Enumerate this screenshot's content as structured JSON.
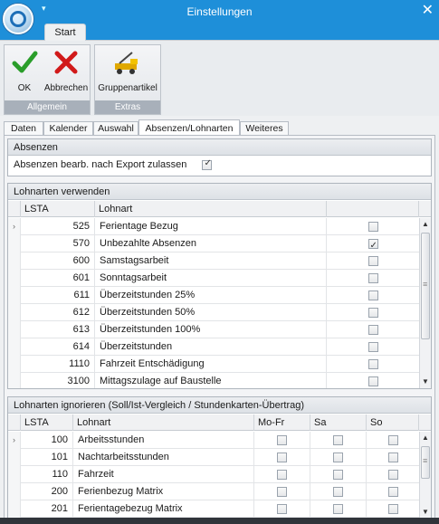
{
  "window": {
    "title": "Einstellungen",
    "close_glyph": "✕",
    "qat_glyph": "▾"
  },
  "ribbon": {
    "tab": "Start",
    "groups": [
      {
        "label": "Allgemein",
        "buttons": [
          {
            "label": "OK",
            "icon": "green-check-icon"
          },
          {
            "label": "Abbrechen",
            "icon": "red-x-icon"
          }
        ]
      },
      {
        "label": "Extras",
        "buttons": [
          {
            "label": "Gruppenartikel",
            "icon": "crane-truck-icon"
          }
        ]
      }
    ]
  },
  "tabs": [
    "Daten",
    "Kalender",
    "Auswahl",
    "Absenzen/Lohnarten",
    "Weiteres"
  ],
  "active_tab": "Absenzen/Lohnarten",
  "absenzen": {
    "header": "Absenzen",
    "option_label": "Absenzen bearb. nach Export zulassen",
    "option_checked": true
  },
  "lohnarten_verwenden": {
    "header": "Lohnarten verwenden",
    "columns": [
      "LSTA",
      "Lohnart",
      ""
    ],
    "rows": [
      {
        "lsta": "525",
        "lohnart": "Ferientage Bezug",
        "checked": false
      },
      {
        "lsta": "570",
        "lohnart": "Unbezahlte Absenzen",
        "checked": true
      },
      {
        "lsta": "600",
        "lohnart": "Samstagsarbeit",
        "checked": false
      },
      {
        "lsta": "601",
        "lohnart": "Sonntagsarbeit",
        "checked": false
      },
      {
        "lsta": "611",
        "lohnart": "Überzeitstunden 25%",
        "checked": false
      },
      {
        "lsta": "612",
        "lohnart": "Überzeitstunden 50%",
        "checked": false
      },
      {
        "lsta": "613",
        "lohnart": "Überzeitstunden 100%",
        "checked": false
      },
      {
        "lsta": "614",
        "lohnart": "Überzeitstunden",
        "checked": false
      },
      {
        "lsta": "1110",
        "lohnart": "Fahrzeit Entschädigung",
        "checked": false
      },
      {
        "lsta": "3100",
        "lohnart": "Mittagszulage auf Baustelle",
        "checked": false
      }
    ]
  },
  "lohnarten_ignorieren": {
    "header": "Lohnarten ignorieren (Soll/Ist-Vergleich / Stundenkarten-Übertrag)",
    "columns": [
      "LSTA",
      "Lohnart",
      "Mo-Fr",
      "Sa",
      "So"
    ],
    "rows": [
      {
        "lsta": "100",
        "lohnart": "Arbeitsstunden"
      },
      {
        "lsta": "101",
        "lohnart": "Nachtarbeitsstunden"
      },
      {
        "lsta": "110",
        "lohnart": "Fahrzeit"
      },
      {
        "lsta": "200",
        "lohnart": "Ferienbezug Matrix"
      },
      {
        "lsta": "201",
        "lohnart": "Ferientagebezug Matrix"
      }
    ]
  },
  "colors": {
    "titlebar": "#1e8fd9",
    "accent_check": "#2a9d2a",
    "accent_x": "#d11a1a"
  }
}
